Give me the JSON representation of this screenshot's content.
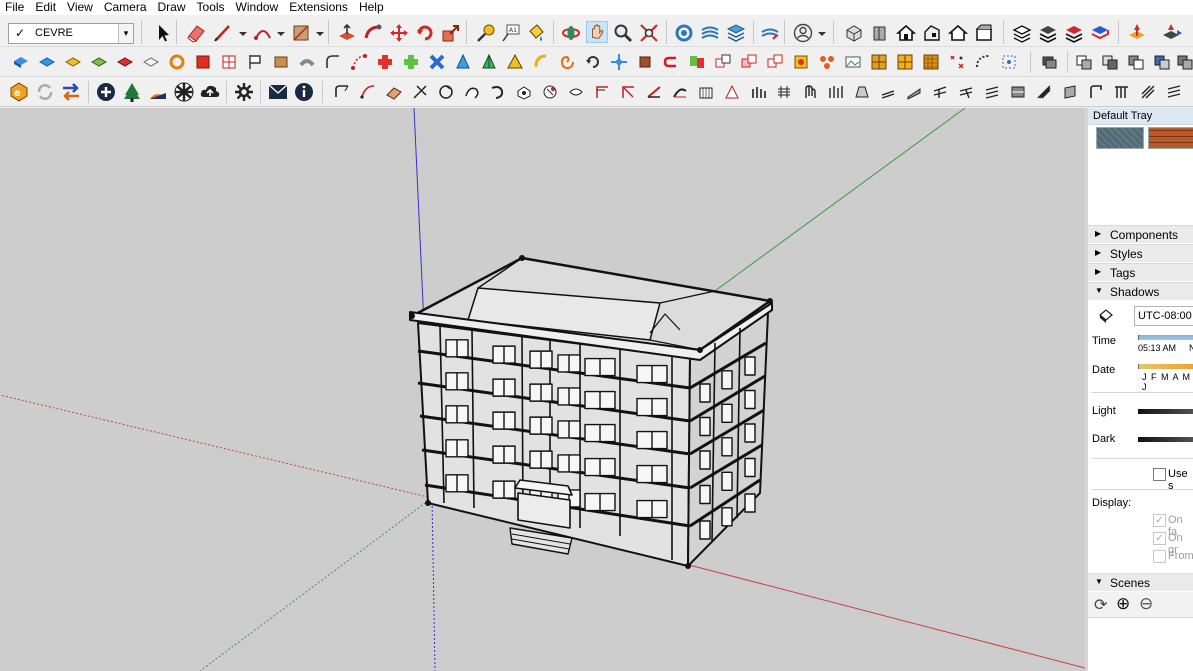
{
  "menu": [
    "File",
    "Edit",
    "View",
    "Camera",
    "Draw",
    "Tools",
    "Window",
    "Extensions",
    "Help"
  ],
  "tag_selector": {
    "checked": "✓",
    "value": "CEVRE",
    "arrow": "▾"
  },
  "tray": {
    "title": "Default Tray",
    "materials": [
      "#5d7680",
      "#b75a2c"
    ],
    "panels": {
      "components": "Components",
      "styles": "Styles",
      "tags": "Tags",
      "shadows": "Shadows",
      "scenes": "Scenes"
    },
    "collapsed_glyph": "▶",
    "expanded_glyph": "▼",
    "shadows": {
      "timezone": "UTC-08:00",
      "time_label": "Time",
      "time_value": "05:13 AM",
      "time_suffix": "N",
      "date_label": "Date",
      "months": "J F M A M J",
      "light_label": "Light",
      "dark_label": "Dark",
      "use_sun_label": "Use s",
      "display_label": "Display:",
      "on_faces_label": "On fa",
      "on_ground_label": "On gr",
      "from_edges_label": "From"
    },
    "scenes": {
      "refresh_icon": "⟳",
      "add_icon": "⊕",
      "remove_icon": "⊖"
    }
  },
  "colors": {
    "viewport_bg": "#cdcdcd",
    "axis_red": "#c84040",
    "axis_green": "#3c9c3c",
    "axis_blue": "#3434c8",
    "tray_header": "#dde8f3"
  }
}
